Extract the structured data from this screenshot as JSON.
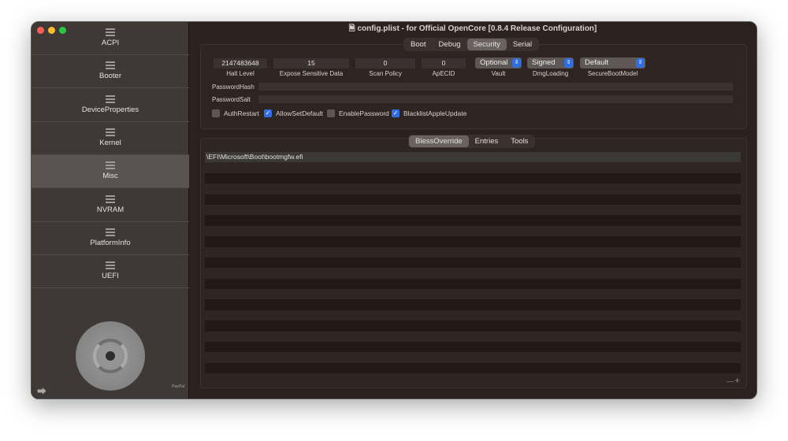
{
  "window": {
    "title": "config.plist - for Official OpenCore [0.8.4 Release Configuration]"
  },
  "sidebar": {
    "items": [
      {
        "label": "ACPI"
      },
      {
        "label": "Booter"
      },
      {
        "label": "DeviceProperties"
      },
      {
        "label": "Kernel"
      },
      {
        "label": "Misc",
        "selected": true
      },
      {
        "label": "NVRAM"
      },
      {
        "label": "PlatformInfo"
      },
      {
        "label": "UEFI"
      }
    ],
    "paypal": "PayPal"
  },
  "top_tabs": [
    {
      "label": "Boot"
    },
    {
      "label": "Debug"
    },
    {
      "label": "Security",
      "selected": true
    },
    {
      "label": "Serial"
    }
  ],
  "security": {
    "halt_level": {
      "value": "2147483648",
      "label": "Halt Level"
    },
    "expose": {
      "value": "15",
      "label": "Expose Sensitive Data"
    },
    "scan_policy": {
      "value": "0",
      "label": "Scan Policy"
    },
    "apecid": {
      "value": "0",
      "label": "ApECID"
    },
    "vault": {
      "value": "Optional",
      "label": "Vault"
    },
    "dmg": {
      "value": "Signed",
      "label": "DmgLoading"
    },
    "secureboot": {
      "value": "Default",
      "label": "SecureBootModel"
    },
    "password_hash": {
      "label": "PasswordHash",
      "value": ""
    },
    "password_salt": {
      "label": "PasswordSalt",
      "value": ""
    },
    "checkboxes": [
      {
        "label": "AuthRestart",
        "checked": false
      },
      {
        "label": "AllowSetDefault",
        "checked": true
      },
      {
        "label": "EnablePassword",
        "checked": false
      },
      {
        "label": "BlacklistAppleUpdate",
        "checked": true
      }
    ]
  },
  "bottom_tabs": [
    {
      "label": "BlessOverride",
      "selected": true
    },
    {
      "label": "Entries"
    },
    {
      "label": "Tools"
    }
  ],
  "bless_rows": [
    "\\EFI\\Microsoft\\Boot\\bootmgfw.efi"
  ],
  "footer": {
    "remove": "—",
    "add": "+"
  },
  "colors": {
    "accent": "#2f6fe0",
    "sidebar": "#3e3836",
    "main": "#2b211f"
  }
}
